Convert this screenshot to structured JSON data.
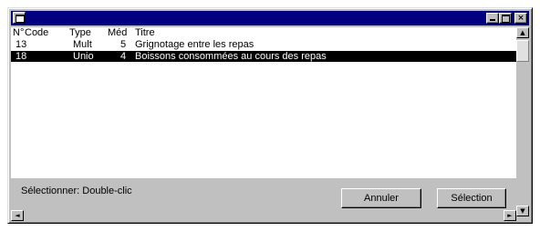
{
  "titlebar": {
    "title": "",
    "close_label": "×"
  },
  "list": {
    "headers": {
      "num": "N°",
      "code": "Code",
      "type": "Type",
      "med": "Méd",
      "titre": "Titre"
    },
    "rows": [
      {
        "code": "13",
        "type": "Mult",
        "med": "5",
        "titre": "Grignotage entre les repas",
        "selected": false
      },
      {
        "code": "18",
        "type": "Unio",
        "med": "4",
        "titre": "Boissons consommées au cours des repas",
        "selected": true
      }
    ]
  },
  "status": {
    "text": "Sélectionner: Double-clic"
  },
  "buttons": {
    "cancel": "Annuler",
    "select": "Sélection"
  },
  "scrollbar": {
    "up": "▲",
    "down": "▼",
    "left": "◄",
    "right": "►"
  },
  "colors": {
    "titlebar": "#000080",
    "face": "#c0c0c0",
    "selection": "#000000"
  }
}
